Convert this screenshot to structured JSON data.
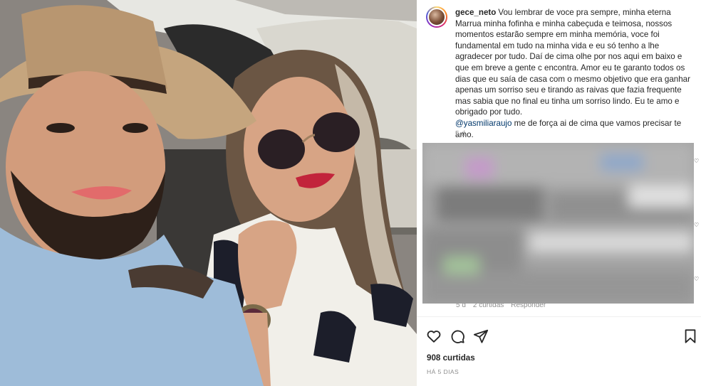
{
  "post": {
    "username": "gece_neto",
    "caption_text": "Vou lembrar de voce pra sempre, minha eterna Marrua minha fofinha e minha cabeçuda e teimosa, nossos momentos estarão sempre em minha memória, voce foi fundamental em tudo na minha vida e eu só tenho a lhe agradecer por tudo. Daí de cima olhe por nos aqui em baixo e que em breve a gente c encontra. Amor eu te garanto todos os dias que eu saía de casa com o mesmo objetivo que era ganhar apenas um sorriso seu e tirando as raivas que fazia frequente mas sabia que no final eu tinha um sorriso lindo. Eu te amo e obrigado por tudo.",
    "mention": "@yasmiliaraujo",
    "caption_tail": "me de força ai de cima que vamos precisar te amo.",
    "time": "5 d"
  },
  "comment": {
    "time": "5 d",
    "likes": "2 curtidas",
    "reply": "Responder"
  },
  "footer": {
    "likes": "908 curtidas",
    "date": "HÁ 5 DIAS"
  },
  "icons": {
    "like": "heart-outline-icon",
    "comment": "comment-bubble-icon",
    "share": "paper-plane-icon",
    "save": "bookmark-icon"
  },
  "colors": {
    "mention": "#00376b",
    "meta": "#8e8e8e",
    "text": "#262626"
  }
}
